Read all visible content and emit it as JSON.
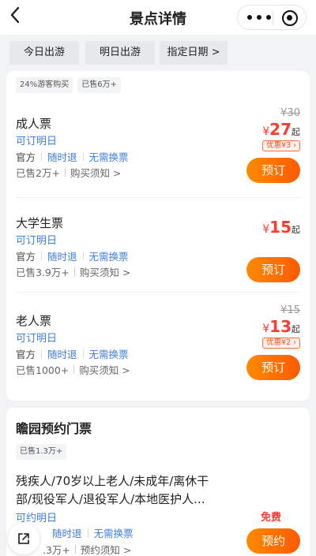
{
  "header": {
    "title": "景点详情",
    "back_icon": "chevron-left-icon",
    "more_icon": "more-dots-icon",
    "target_icon": "target-icon"
  },
  "date_bar": {
    "today": "今日出游",
    "tomorrow": "明日出游",
    "pick_date": "指定日期 >"
  },
  "card1": {
    "tags": [
      "24%游客购买",
      "已售6万+"
    ],
    "tickets": [
      {
        "name": "成人票",
        "availability": "可订明日",
        "feature_official": "官方",
        "feature_refund": "随时退",
        "feature_noexchange": "无需换票",
        "sold": "已售2万+",
        "notice": "购买须知 >",
        "original_price": "¥30",
        "currency": "¥",
        "price": "27",
        "price_suffix": "起",
        "discount": "优惠¥3",
        "book_label": "预订"
      },
      {
        "name": "大学生票",
        "availability": "可订明日",
        "feature_official": "官方",
        "feature_refund": "随时退",
        "feature_noexchange": "无需换票",
        "sold": "已售3.9万+",
        "notice": "购买须知 >",
        "currency": "¥",
        "price": "15",
        "price_suffix": "起",
        "book_label": "预订"
      },
      {
        "name": "老人票",
        "availability": "可订明日",
        "feature_official": "官方",
        "feature_refund": "随时退",
        "feature_noexchange": "无需换票",
        "sold": "已售1000+",
        "notice": "购买须知 >",
        "original_price": "¥15",
        "currency": "¥",
        "price": "13",
        "price_suffix": "起",
        "discount": "优惠¥2",
        "book_label": "预订"
      }
    ]
  },
  "card2": {
    "title": "瞻园预约门票",
    "tag": "已售1.3万+",
    "description_line1": "残疾人/70岁以上老人/未成年/离休干",
    "description_line2": "部/现役军人/退役军人/本地医护人...",
    "availability": "可约明日",
    "feature_refund": "随时退",
    "feature_noexchange": "无需换票",
    "sold": ".3万+",
    "notice": "预约须知 >",
    "price_label": "免费",
    "book_label": "预约"
  },
  "share_icon": "share-icon"
}
